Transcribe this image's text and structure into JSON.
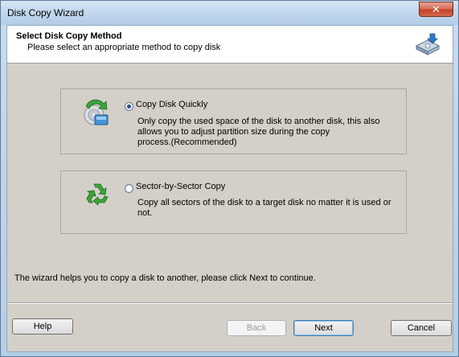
{
  "window": {
    "title": "Disk Copy Wizard",
    "close_glyph": "✕"
  },
  "header": {
    "title": "Select Disk Copy Method",
    "subtitle": "Please select an appropriate method to copy disk",
    "icon": "disk-copy-icon"
  },
  "options": [
    {
      "label": "Copy Disk Quickly",
      "selected": true,
      "icon": "disk-arrow-icon",
      "desc_lines": [
        "Only copy the used space of the disk to another disk, this also",
        "allows you to adjust partition size during the copy",
        "process.(Recommended)"
      ]
    },
    {
      "label": "Sector-by-Sector Copy",
      "selected": false,
      "icon": "recycle-icon",
      "desc_lines": [
        "Copy all sectors of the disk to a target disk no matter it is used or",
        "not."
      ]
    }
  ],
  "footer": {
    "text": "The wizard helps you to copy a disk to another, please click Next to continue."
  },
  "buttons": {
    "help": "Help",
    "back": "Back",
    "next": "Next",
    "cancel": "Cancel"
  }
}
